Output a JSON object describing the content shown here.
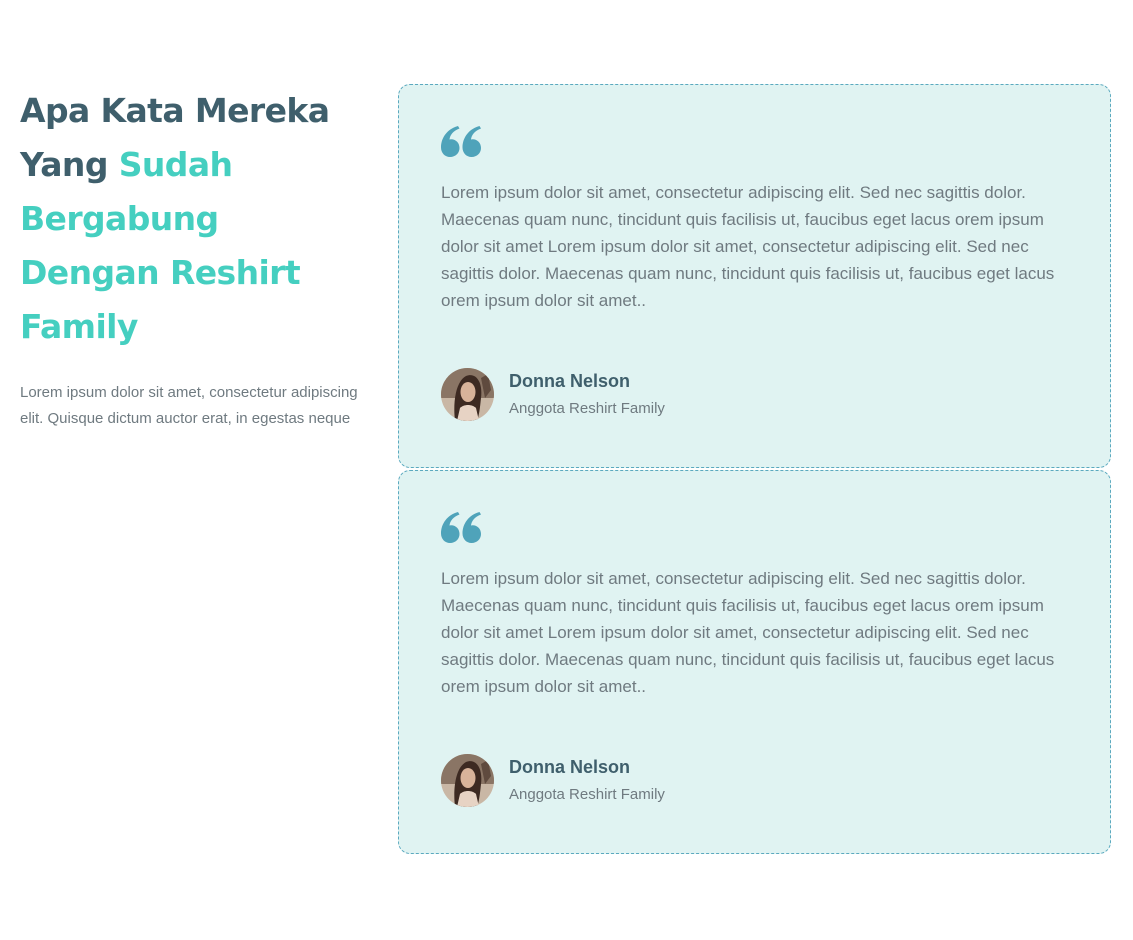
{
  "section": {
    "heading_part1": "Apa Kata Mereka Yang ",
    "heading_part2": "Sudah Bergabung Dengan Reshirt Family",
    "intro": "Lorem ipsum dolor sit amet, consectetur adipiscing elit. Quisque dictum auctor erat, in egestas neque"
  },
  "testimonials": [
    {
      "text": "Lorem ipsum dolor sit amet, consectetur adipiscing elit. Sed nec sagittis dolor. Maecenas quam nunc, tincidunt quis facilisis ut, faucibus eget lacus orem ipsum dolor sit amet Lorem ipsum dolor sit amet, consectetur adipiscing elit. Sed nec sagittis dolor. Maecenas quam nunc, tincidunt quis facilisis ut, faucibus eget lacus orem ipsum dolor sit amet..",
      "name": "Donna Nelson",
      "role": "Anggota Reshirt Family"
    },
    {
      "text": "Lorem ipsum dolor sit amet, consectetur adipiscing elit. Sed nec sagittis dolor. Maecenas quam nunc, tincidunt quis facilisis ut, faucibus eget lacus orem ipsum dolor sit amet Lorem ipsum dolor sit amet, consectetur adipiscing elit. Sed nec sagittis dolor. Maecenas quam nunc, tincidunt quis facilisis ut, faucibus eget lacus orem ipsum dolor sit amet..",
      "name": "Donna Nelson",
      "role": "Anggota Reshirt Family"
    }
  ],
  "icons": {
    "quote": "quote-icon",
    "avatar": "user-avatar"
  },
  "colors": {
    "heading_dark": "#3f5f6c",
    "heading_accent": "#45cfc0",
    "card_bg": "#e0f3f2",
    "card_border": "#5ba9bf",
    "quote_icon": "#4fa3ba",
    "body_text": "#6f7a80"
  }
}
